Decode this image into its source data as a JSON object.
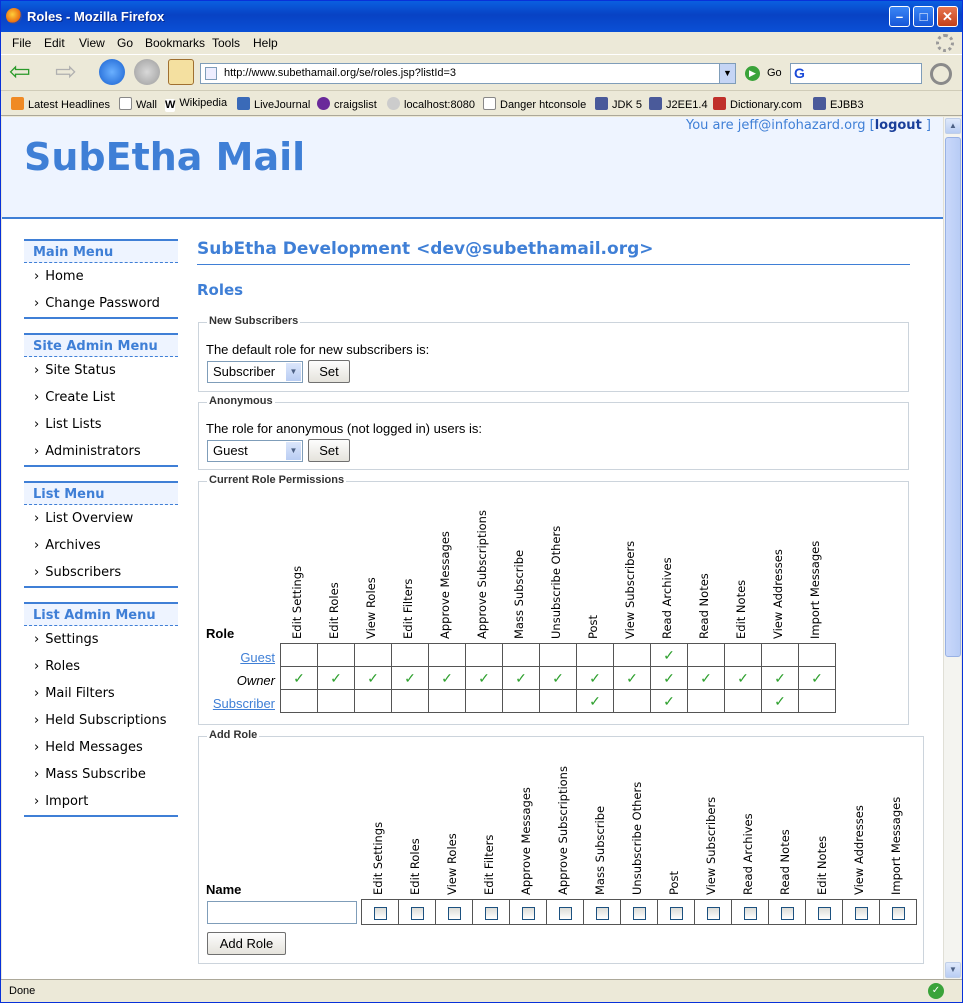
{
  "browser": {
    "window_title": "Roles - Mozilla Firefox",
    "menus": [
      "File",
      "Edit",
      "View",
      "Go",
      "Bookmarks",
      "Tools",
      "Help"
    ],
    "url": "http://www.subethamail.org/se/roles.jsp?listId=3",
    "go_label": "Go",
    "bookmarks": [
      "Latest Headlines",
      "Wall",
      "Wikipedia",
      "LiveJournal",
      "craigslist",
      "localhost:8080",
      "Danger htconsole",
      "JDK 5",
      "J2EE1.4",
      "Dictionary.com",
      "EJBB3"
    ],
    "status": "Done"
  },
  "header": {
    "brand": "SubEtha Mail",
    "user_prefix": "You are jeff@infohazard.org [",
    "logout": "logout",
    "user_suffix": " ]"
  },
  "sidebar": {
    "main_menu": {
      "title": "Main Menu",
      "items": [
        "Home",
        "Change Password"
      ]
    },
    "site_admin_menu": {
      "title": "Site Admin Menu",
      "items": [
        "Site Status",
        "Create List",
        "List Lists",
        "Administrators"
      ]
    },
    "list_menu": {
      "title": "List Menu",
      "items": [
        "List Overview",
        "Archives",
        "Subscribers"
      ]
    },
    "list_admin_menu": {
      "title": "List Admin Menu",
      "items": [
        "Settings",
        "Roles",
        "Mail Filters",
        "Held Subscriptions",
        "Held Messages",
        "Mass Subscribe",
        "Import"
      ]
    }
  },
  "main": {
    "list_title": "SubEtha Development <dev@subethamail.org>",
    "page_title": "Roles",
    "new_subscribers": {
      "legend": "New Subscribers",
      "text": "The default role for new subscribers is:",
      "selected": "Subscriber",
      "button": "Set"
    },
    "anonymous": {
      "legend": "Anonymous",
      "text": "The role for anonymous (not logged in) users is:",
      "selected": "Guest",
      "button": "Set"
    },
    "current": {
      "legend": "Current Role Permissions",
      "role_header": "Role",
      "permissions": [
        "Edit Settings",
        "Edit Roles",
        "View Roles",
        "Edit Filters",
        "Approve Messages",
        "Approve Subscriptions",
        "Mass Subscribe",
        "Unsubscribe Others",
        "Post",
        "View Subscribers",
        "Read Archives",
        "Read Notes",
        "Edit Notes",
        "View Addresses",
        "Import Messages"
      ],
      "check_mark": "✓",
      "roles": [
        {
          "name": "Guest",
          "style": "link",
          "grants": [
            0,
            0,
            0,
            0,
            0,
            0,
            0,
            0,
            0,
            0,
            1,
            0,
            0,
            0,
            0
          ]
        },
        {
          "name": "Owner",
          "style": "italic",
          "grants": [
            1,
            1,
            1,
            1,
            1,
            1,
            1,
            1,
            1,
            1,
            1,
            1,
            1,
            1,
            1
          ]
        },
        {
          "name": "Subscriber",
          "style": "link",
          "grants": [
            0,
            0,
            0,
            0,
            0,
            0,
            0,
            0,
            1,
            0,
            1,
            0,
            0,
            1,
            0
          ]
        }
      ]
    },
    "add_role": {
      "legend": "Add Role",
      "name_header": "Name",
      "button": "Add Role"
    }
  }
}
